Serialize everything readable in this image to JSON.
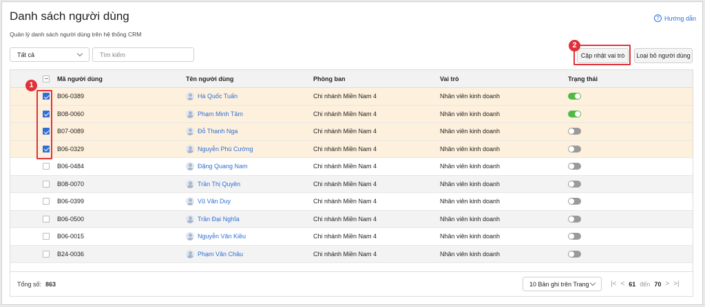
{
  "header": {
    "title": "Danh sách người dùng",
    "subtitle": "Quản lý danh sách người dùng trên hệ thống CRM",
    "help_label": "Hướng dẫn"
  },
  "filters": {
    "status_selected": "Tất cả",
    "search_placeholder": "Tìm kiếm"
  },
  "actions": {
    "update_role_label": "Cập nhật vai trò",
    "remove_user_label": "Loại bỏ người dùng"
  },
  "annotations": {
    "step1": "1",
    "step2": "2",
    "highlight_color": "#e0303a"
  },
  "table": {
    "columns": {
      "code": "Mã người dùng",
      "name": "Tên người dùng",
      "department": "Phòng ban",
      "role": "Vai trò",
      "status": "Trạng thái"
    },
    "rows": [
      {
        "code": "B06-0389",
        "name": "Hà Quốc Tuấn",
        "department": "Chi nhánh Miền Nam 4",
        "role": "Nhân viên kinh doanh",
        "selected": true,
        "active": true
      },
      {
        "code": "B08-0060",
        "name": "Phạm Minh Tâm",
        "department": "Chi nhánh Miền Nam 4",
        "role": "Nhân viên kinh doanh",
        "selected": true,
        "active": true
      },
      {
        "code": "B07-0089",
        "name": "Đỗ Thanh Nga",
        "department": "Chi nhánh Miền Nam 4",
        "role": "Nhân viên kinh doanh",
        "selected": true,
        "active": false
      },
      {
        "code": "B06-0329",
        "name": "Nguyễn Phú Cường",
        "department": "Chi nhánh Miền Nam 4",
        "role": "Nhân viên kinh doanh",
        "selected": true,
        "active": false
      },
      {
        "code": "B06-0484",
        "name": "Đặng Quang Nam",
        "department": "Chi nhánh Miền Nam 4",
        "role": "Nhân viên kinh doanh",
        "selected": false,
        "active": false
      },
      {
        "code": "B08-0070",
        "name": "Trần Thị Quyên",
        "department": "Chi nhánh Miền Nam 4",
        "role": "Nhân viên kinh doanh",
        "selected": false,
        "active": false
      },
      {
        "code": "B06-0399",
        "name": "Vũ Văn Duy",
        "department": "Chi nhánh Miền Nam 4",
        "role": "Nhân viên kinh doanh",
        "selected": false,
        "active": false
      },
      {
        "code": "B06-0500",
        "name": "Trần Đại Nghĩa",
        "department": "Chi nhánh Miền Nam 4",
        "role": "Nhân viên kinh doanh",
        "selected": false,
        "active": false
      },
      {
        "code": "B06-0015",
        "name": "Nguyễn Văn Kiều",
        "department": "Chi nhánh Miền Nam 4",
        "role": "Nhân viên kinh doanh",
        "selected": false,
        "active": false
      },
      {
        "code": "B24-0036",
        "name": "Phạm Văn Châu",
        "department": "Chi nhánh Miền Nam 4",
        "role": "Nhân viên kinh doanh",
        "selected": false,
        "active": false
      }
    ]
  },
  "footer": {
    "total_label": "Tổng số:",
    "total_value": "863",
    "page_size_label": "10 Bản ghi trên Trang",
    "range_start": "61",
    "range_sep": "đến",
    "range_end": "70"
  },
  "colors": {
    "accent": "#2f6fd6",
    "selected_row": "#fdf0dd",
    "toggle_on": "#52b947"
  }
}
